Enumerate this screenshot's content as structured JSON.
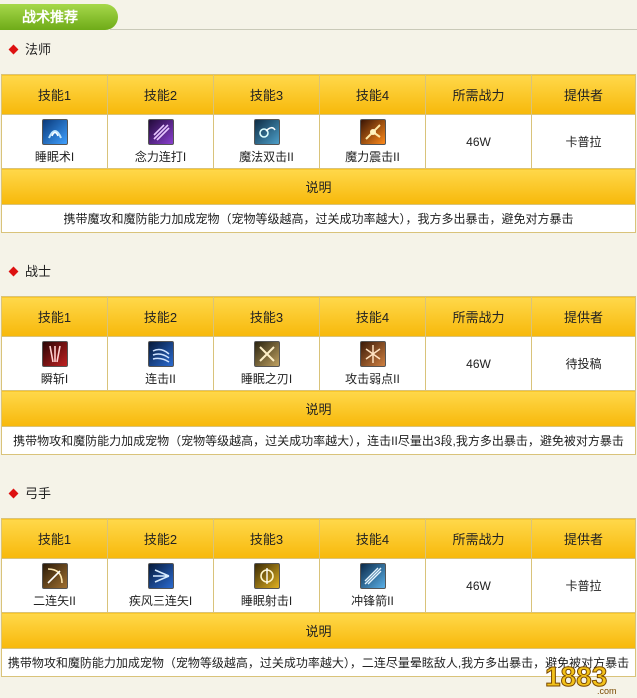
{
  "page_title": "战术推荐",
  "columns": [
    "技能1",
    "技能2",
    "技能3",
    "技能4",
    "所需战力",
    "提供者"
  ],
  "note_label": "说明",
  "sections": [
    {
      "name": "法师",
      "skills": [
        {
          "name": "睡眠术I",
          "icon": "sleep-spell-icon"
        },
        {
          "name": "念力连打I",
          "icon": "telekinesis-combo-icon"
        },
        {
          "name": "魔法双击II",
          "icon": "magic-double-strike-icon"
        },
        {
          "name": "魔力震击II",
          "icon": "mana-shock-icon"
        }
      ],
      "power": "46W",
      "provider": "卡普拉",
      "description": "携带魔攻和魔防能力加成宠物（宠物等级越高，过关成功率越大），我方多出暴击，避免对方暴击"
    },
    {
      "name": "战士",
      "skills": [
        {
          "name": "瞬斩I",
          "icon": "instant-slash-icon"
        },
        {
          "name": "连击II",
          "icon": "combo-strike-icon"
        },
        {
          "name": "睡眠之刃I",
          "icon": "sleep-blade-icon"
        },
        {
          "name": "攻击弱点II",
          "icon": "attack-weakness-icon"
        }
      ],
      "power": "46W",
      "provider": "待投稿",
      "description": "携带物攻和魔防能力加成宠物（宠物等级越高，过关成功率越大），连击II尽量出3段,我方多出暴击，避免被对方暴击"
    },
    {
      "name": "弓手",
      "skills": [
        {
          "name": "二连矢II",
          "icon": "double-arrow-icon"
        },
        {
          "name": "疾风三连矢I",
          "icon": "gale-triple-arrow-icon"
        },
        {
          "name": "睡眠射击I",
          "icon": "sleep-shot-icon"
        },
        {
          "name": "冲锋箭II",
          "icon": "charge-arrow-icon"
        }
      ],
      "power": "46W",
      "provider": "卡普拉",
      "description": "携带物攻和魔防能力加成宠物（宠物等级越高，过关成功率越大），二连尽量晕眩敌人,我方多出暴击，避免被对方暴击"
    }
  ],
  "watermark_text": "1883",
  "watermark_sub": ".com",
  "colors": {
    "header_gold": "#f7b80a",
    "title_green": "#6eab18",
    "bullet_red": "#dd1111"
  }
}
